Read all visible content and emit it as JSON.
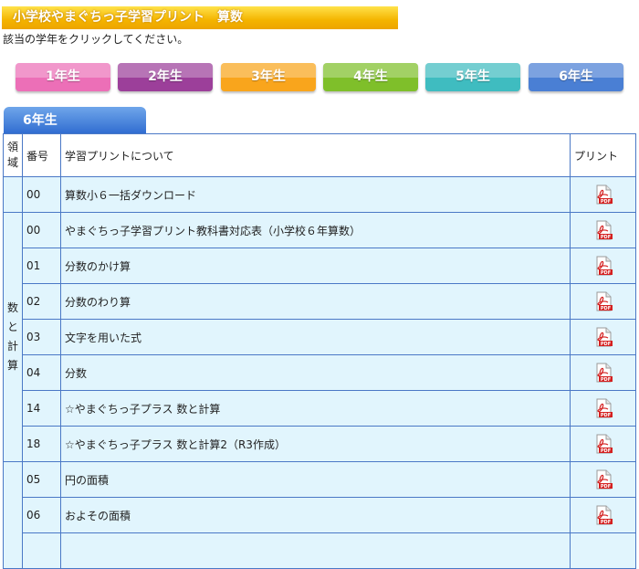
{
  "page": {
    "title": "小学校やまぐちっ子学習プリント　算数",
    "instruction": "該当の学年をクリックしてください。"
  },
  "grades": [
    {
      "label": "1年生",
      "color": "#ec6fb7"
    },
    {
      "label": "2年生",
      "color": "#9c3f9a"
    },
    {
      "label": "3年生",
      "color": "#f9a51c"
    },
    {
      "label": "4年生",
      "color": "#7fbf2a"
    },
    {
      "label": "5年生",
      "color": "#3fbcc0"
    },
    {
      "label": "6年生",
      "color": "#4a7fd4"
    }
  ],
  "section": {
    "label": "6年生"
  },
  "table": {
    "headers": {
      "ryoiki": "領域",
      "number": "番号",
      "about": "学習プリントについて",
      "print": "プリント"
    },
    "groups": [
      {
        "ryoiki": "",
        "rows": [
          {
            "number": "00",
            "title": "算数小６一括ダウンロード",
            "icon": "pdf-icon"
          }
        ]
      },
      {
        "ryoiki": "数と計算",
        "rows": [
          {
            "number": "00",
            "title": "やまぐちっ子学習プリント教科書対応表（小学校６年算数）",
            "icon": "pdf-icon"
          },
          {
            "number": "01",
            "title": "分数のかけ算",
            "icon": "pdf-icon"
          },
          {
            "number": "02",
            "title": "分数のわり算",
            "icon": "pdf-icon"
          },
          {
            "number": "03",
            "title": "文字を用いた式",
            "icon": "pdf-icon"
          },
          {
            "number": "04",
            "title": "分数",
            "icon": "pdf-icon"
          },
          {
            "number": "14",
            "title": "☆やまぐちっ子プラス 数と計算",
            "icon": "pdf-icon"
          },
          {
            "number": "18",
            "title": "☆やまぐちっ子プラス 数と計算2（R3作成）",
            "icon": "pdf-icon"
          }
        ]
      },
      {
        "ryoiki": "",
        "rows": [
          {
            "number": "05",
            "title": "円の面積",
            "icon": "pdf-icon"
          },
          {
            "number": "06",
            "title": "およその面積",
            "icon": "pdf-icon"
          },
          {
            "number": "",
            "title": "",
            "icon": ""
          }
        ]
      }
    ]
  }
}
